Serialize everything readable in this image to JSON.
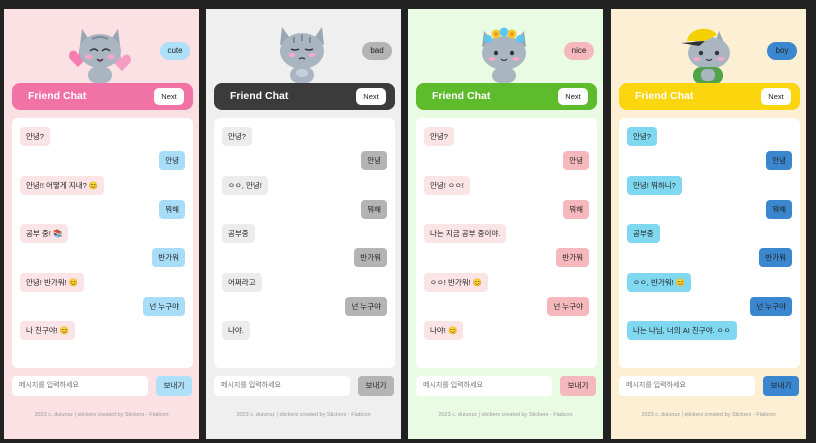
{
  "panels": [
    {
      "mood": "cute",
      "header_title": "Friend Chat",
      "next_label": "Next",
      "messages": [
        {
          "side": "left",
          "text": "안녕?"
        },
        {
          "side": "right",
          "text": "안녕"
        },
        {
          "side": "left",
          "text": "안녕!! 어떻게 지내? 😊"
        },
        {
          "side": "right",
          "text": "뭐해"
        },
        {
          "side": "left",
          "text": "공부 중! 📚"
        },
        {
          "side": "right",
          "text": "반가워"
        },
        {
          "side": "left",
          "text": "안녕! 반가워! 😊"
        },
        {
          "side": "right",
          "text": "넌 누구야"
        },
        {
          "side": "left",
          "text": "나 친구야! 😊"
        }
      ],
      "input_placeholder": "메시지를 입력하세요",
      "send_label": "보내기",
      "footer": "2023 c. duiunsz | stickers created by Stickers - Flaticon",
      "colors": {
        "header": "#f172a5",
        "bot_bubble": "#fbe4e6",
        "user_bubble": "#a8ddf8",
        "mood_chip": "#aee0fa",
        "send_button": "#aee0fa"
      }
    },
    {
      "mood": "bad",
      "header_title": "Friend Chat",
      "next_label": "Next",
      "messages": [
        {
          "side": "left",
          "text": "안녕?"
        },
        {
          "side": "right",
          "text": "안녕"
        },
        {
          "side": "left",
          "text": "ㅇㅇ, 안녕!"
        },
        {
          "side": "right",
          "text": "뭐해"
        },
        {
          "side": "left",
          "text": "공부중"
        },
        {
          "side": "right",
          "text": "반가워"
        },
        {
          "side": "left",
          "text": "어쩌라고"
        },
        {
          "side": "right",
          "text": "넌 누구야"
        },
        {
          "side": "left",
          "text": "나야."
        }
      ],
      "input_placeholder": "메시지를 입력하세요",
      "send_label": "보내기",
      "footer": "2023 c. duiunsz | stickers created by Stickers - Flaticon",
      "colors": {
        "header": "#3b3b3b",
        "bot_bubble": "#ececec",
        "user_bubble": "#b4b4b4",
        "mood_chip": "#b4b4b4",
        "send_button": "#b4b4b4"
      }
    },
    {
      "mood": "nice",
      "header_title": "Friend Chat",
      "next_label": "Next",
      "messages": [
        {
          "side": "left",
          "text": "안녕?"
        },
        {
          "side": "right",
          "text": "안녕"
        },
        {
          "side": "left",
          "text": "안녕! ㅇㅇ!"
        },
        {
          "side": "right",
          "text": "뭐해"
        },
        {
          "side": "left",
          "text": "나는 지금 공부 중이야."
        },
        {
          "side": "right",
          "text": "반가워"
        },
        {
          "side": "left",
          "text": "ㅇㅇ! 반가워! 😊"
        },
        {
          "side": "right",
          "text": "넌 누구야"
        },
        {
          "side": "left",
          "text": "나야! 😊"
        }
      ],
      "input_placeholder": "메시지를 입력하세요",
      "send_label": "보내기",
      "footer": "2023 c. duiunsz | stickers created by Stickers - Flaticon",
      "colors": {
        "header": "#5dbb2c",
        "bot_bubble": "#fbe4e6",
        "user_bubble": "#f5b8bc",
        "mood_chip": "#f5b8bc",
        "send_button": "#f5b8bc"
      }
    },
    {
      "mood": "boy",
      "header_title": "Friend Chat",
      "next_label": "Next",
      "messages": [
        {
          "side": "left",
          "text": "안녕?"
        },
        {
          "side": "right",
          "text": "안녕"
        },
        {
          "side": "left",
          "text": "안녕! 뭐하니?"
        },
        {
          "side": "right",
          "text": "뭐해"
        },
        {
          "side": "left",
          "text": "공부중"
        },
        {
          "side": "right",
          "text": "반가워"
        },
        {
          "side": "left",
          "text": "ㅇㅇ, 반가워! 😊"
        },
        {
          "side": "right",
          "text": "넌 누구야"
        },
        {
          "side": "left",
          "text": "나는 나님, 너의 AI 친구야. ㅇㅇ"
        }
      ],
      "input_placeholder": "메시지를 입력하세요",
      "send_label": "보내기",
      "footer": "2023 c. duiunsz | stickers created by Stickers - Flaticon",
      "colors": {
        "header": "#fbd50e",
        "bot_bubble": "#7fd8f0",
        "user_bubble": "#3a87cf",
        "mood_chip": "#3a87cf",
        "send_button": "#3a87cf"
      }
    }
  ]
}
